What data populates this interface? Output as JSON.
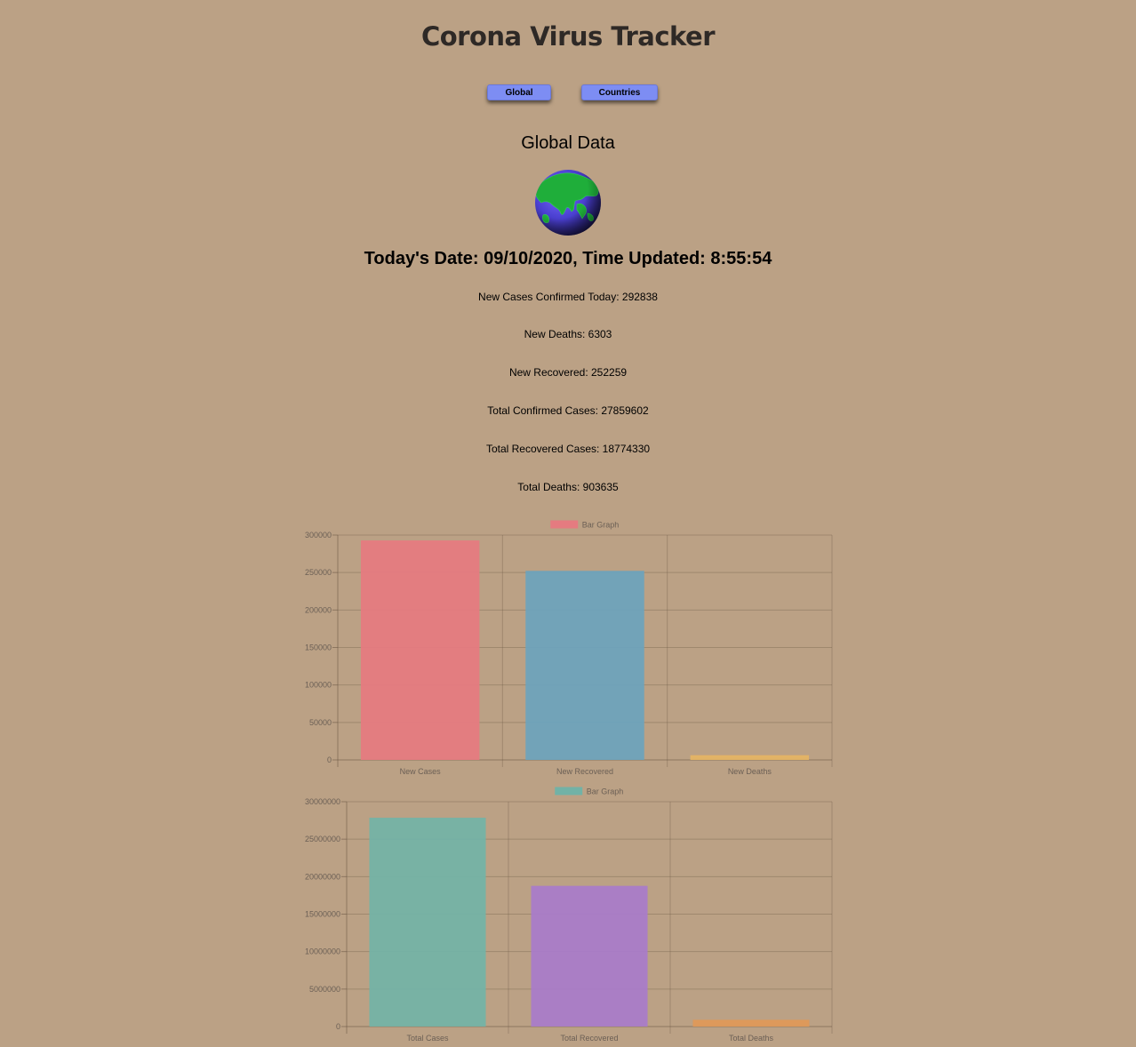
{
  "app": {
    "title": "Corona Virus Tracker"
  },
  "nav": {
    "global_label": "Global",
    "countries_label": "Countries"
  },
  "main": {
    "section_title": "Global Data",
    "date_line": "Today's Date: 09/10/2020, Time Updated: 8:55:54",
    "stats": [
      "New Cases Confirmed Today: 292838",
      "New Deaths: 6303",
      "New Recovered: 252259",
      "Total Confirmed Cases: 27859602",
      "Total Recovered Cases: 18774330",
      "Total Deaths: 903635"
    ]
  },
  "colors": {
    "background": "#bba185",
    "button": "#7d8df3"
  },
  "chart_data": [
    {
      "type": "bar",
      "legend": "Bar Graph",
      "legend_color": "#e57b80",
      "categories": [
        "New Cases",
        "New Recovered",
        "New Deaths"
      ],
      "values": [
        292838,
        252259,
        6303
      ],
      "colors": [
        "#e67a80",
        "#6ba3bd",
        "#e5b464"
      ],
      "ylim": [
        0,
        300000
      ],
      "yticks": [
        0,
        50000,
        100000,
        150000,
        200000,
        250000,
        300000
      ],
      "ytick_labels": [
        "0",
        "50000",
        "100000",
        "150000",
        "200000",
        "250000",
        "300000"
      ],
      "grid": true
    },
    {
      "type": "bar",
      "legend": "Bar Graph",
      "legend_color": "#72b2a6",
      "categories": [
        "Total Cases",
        "Total Recovered",
        "Total Deaths"
      ],
      "values": [
        27859602,
        18774330,
        903635
      ],
      "colors": [
        "#72b3a7",
        "#a87bcb",
        "#e09858"
      ],
      "ylim": [
        0,
        30000000
      ],
      "yticks": [
        0,
        5000000,
        10000000,
        15000000,
        20000000,
        25000000,
        30000000
      ],
      "ytick_labels": [
        "0",
        "5000000",
        "10000000",
        "15000000",
        "20000000",
        "25000000",
        "30000000"
      ],
      "grid": true
    }
  ]
}
